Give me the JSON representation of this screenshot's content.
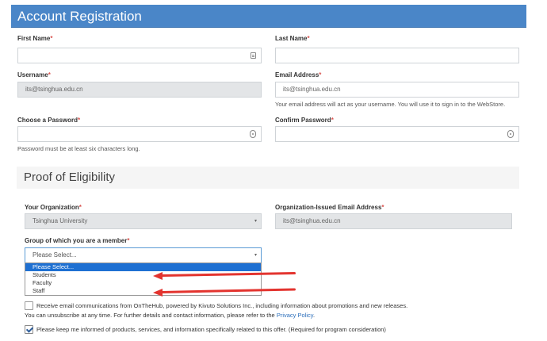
{
  "header": {
    "title": "Account Registration"
  },
  "account": {
    "first_name": {
      "label": "First Name",
      "required": "*",
      "value": ""
    },
    "last_name": {
      "label": "Last Name",
      "required": "*",
      "value": ""
    },
    "username": {
      "label": "Username",
      "required": "*",
      "value": "its@tsinghua.edu.cn"
    },
    "email": {
      "label": "Email Address",
      "required": "*",
      "value": "its@tsinghua.edu.cn",
      "help": "Your email address will act as your username. You will use it to sign in to the WebStore."
    },
    "password": {
      "label": "Choose a Password",
      "required": "*",
      "value": "",
      "help": "Password must be at least six characters long."
    },
    "confirm_password": {
      "label": "Confirm Password",
      "required": "*",
      "value": ""
    }
  },
  "eligibility": {
    "title": "Proof of Eligibility",
    "organization": {
      "label": "Your Organization",
      "required": "*",
      "value": "Tsinghua University"
    },
    "org_email": {
      "label": "Organization-Issued Email Address",
      "required": "*",
      "value": "its@tsinghua.edu.cn"
    },
    "group": {
      "label": "Group of which you are a member",
      "required": "*",
      "selected": "Please Select...",
      "options": [
        "Please Select...",
        "Students",
        "Faculty",
        "Staff"
      ]
    }
  },
  "consent": {
    "receive_email": "Receive email communications from OnTheHub, powered by Kivuto Solutions Inc., including information about promotions and new releases.",
    "unsubscribe_text": "You can unsubscribe at any time. For further details and contact information, please refer to the",
    "privacy_link": "Privacy Policy",
    "unsubscribe_end": ".",
    "keep_informed": "Please keep me informed of products, services, and information specifically related to this offer. (Required for program consideration)"
  },
  "icons": {
    "id_card": "id-card-icon",
    "password_key": "password-key-icon",
    "select_caret": "▾"
  },
  "colors": {
    "header_bg": "#4a86c8",
    "required": "#d9534f",
    "selected_option": "#1e70d2",
    "annotation_arrow": "#e3342f",
    "link": "#2a6ebb"
  }
}
